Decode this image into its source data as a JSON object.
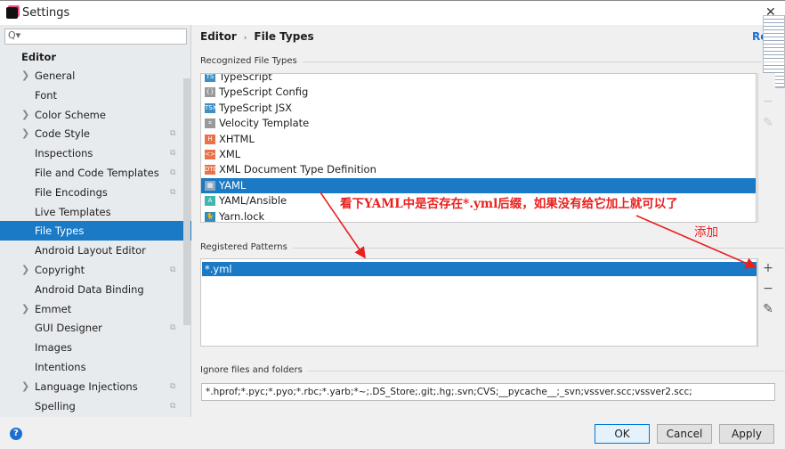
{
  "window": {
    "title": "Settings",
    "close": "✕"
  },
  "sidebar": {
    "search_placeholder": "Q▾",
    "section": "Editor",
    "items": [
      {
        "label": "General",
        "expandable": true,
        "copy": false
      },
      {
        "label": "Font",
        "expandable": false,
        "copy": false
      },
      {
        "label": "Color Scheme",
        "expandable": true,
        "copy": false
      },
      {
        "label": "Code Style",
        "expandable": true,
        "copy": true
      },
      {
        "label": "Inspections",
        "expandable": false,
        "copy": true
      },
      {
        "label": "File and Code Templates",
        "expandable": false,
        "copy": true
      },
      {
        "label": "File Encodings",
        "expandable": false,
        "copy": true
      },
      {
        "label": "Live Templates",
        "expandable": false,
        "copy": false
      },
      {
        "label": "File Types",
        "expandable": false,
        "copy": false,
        "selected": true
      },
      {
        "label": "Android Layout Editor",
        "expandable": false,
        "copy": false
      },
      {
        "label": "Copyright",
        "expandable": true,
        "copy": true
      },
      {
        "label": "Android Data Binding",
        "expandable": false,
        "copy": false
      },
      {
        "label": "Emmet",
        "expandable": true,
        "copy": false
      },
      {
        "label": "GUI Designer",
        "expandable": false,
        "copy": true
      },
      {
        "label": "Images",
        "expandable": false,
        "copy": false
      },
      {
        "label": "Intentions",
        "expandable": false,
        "copy": false
      },
      {
        "label": "Language Injections",
        "expandable": true,
        "copy": true
      },
      {
        "label": "Spelling",
        "expandable": false,
        "copy": true
      }
    ]
  },
  "breadcrumb": {
    "parent": "Editor",
    "sep": "›",
    "current": "File Types",
    "reset": "Re"
  },
  "recognized": {
    "label": "Recognized File Types",
    "items": [
      {
        "label": "TypeScript",
        "icon": "TS",
        "color": "#3d8fc6"
      },
      {
        "label": "TypeScript Config",
        "icon": "{}",
        "color": "#999999"
      },
      {
        "label": "TypeScript JSX",
        "icon": "TSX",
        "color": "#3d8fc6"
      },
      {
        "label": "Velocity Template",
        "icon": "⌗",
        "color": "#999999"
      },
      {
        "label": "XHTML",
        "icon": "H",
        "color": "#e8734a"
      },
      {
        "label": "XML",
        "icon": "<>",
        "color": "#e8734a"
      },
      {
        "label": "XML Document Type Definition",
        "icon": "DTD",
        "color": "#e8734a"
      },
      {
        "label": "YAML",
        "icon": "▦",
        "color": "#8fa8c0",
        "selected": true
      },
      {
        "label": "YAML/Ansible",
        "icon": "A",
        "color": "#3fb6b0"
      },
      {
        "label": "Yarn.lock",
        "icon": "🐈",
        "color": "#2c8ebb"
      }
    ]
  },
  "patterns": {
    "label": "Registered Patterns",
    "items": [
      "*.yml"
    ]
  },
  "toolbar": {
    "add": "+",
    "remove": "−",
    "edit": "✎"
  },
  "ignore": {
    "label": "Ignore files and folders",
    "value": "*.hprof;*.pyc;*.pyo;*.rbc;*.yarb;*~;.DS_Store;.git;.hg;.svn;CVS;__pycache__;_svn;vssver.scc;vssver2.scc;"
  },
  "buttons": {
    "ok": "OK",
    "cancel": "Cancel",
    "apply": "Apply",
    "help": "?"
  },
  "annotations": {
    "main": "看下YAML中是否存在*.yml后缀，如果没有给它加上就可以了",
    "add": "添加"
  },
  "colors": {
    "accent": "#1b7ac5",
    "annotation": "#e8201e"
  }
}
